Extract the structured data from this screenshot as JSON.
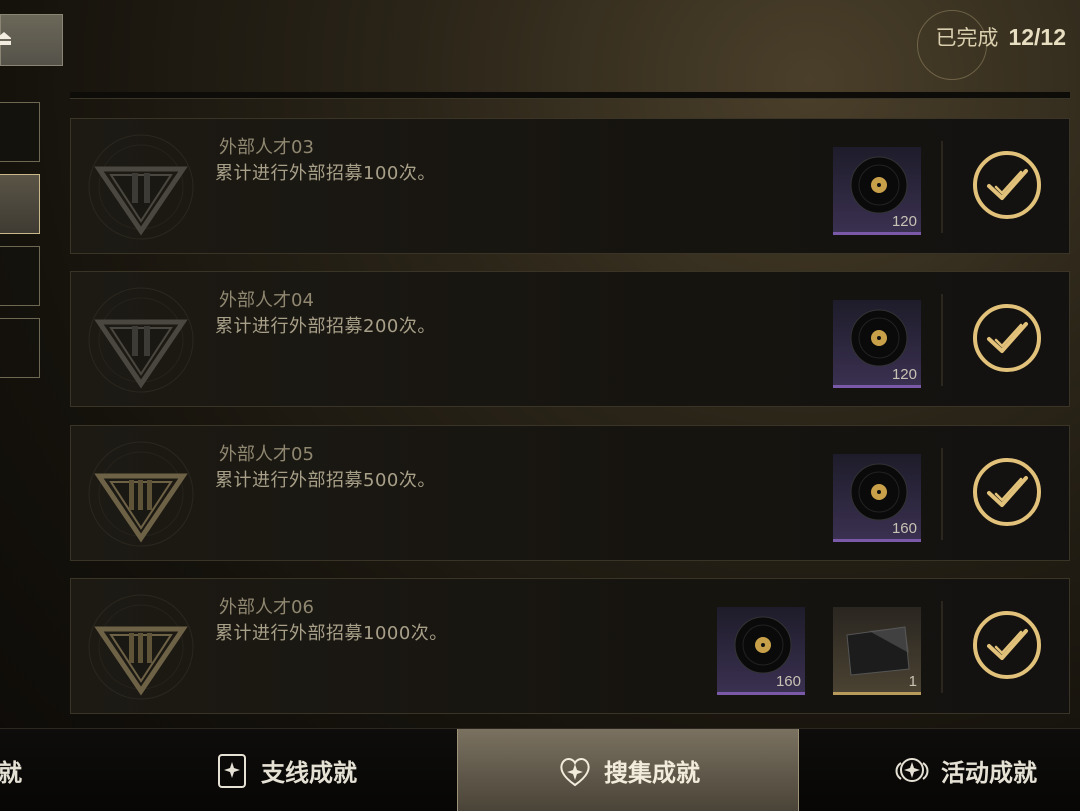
{
  "header": {
    "completed_label": "已完成",
    "completed_value": "12/12"
  },
  "side_tabs": [
    {
      "id": "side-tab-1"
    },
    {
      "id": "side-tab-2"
    },
    {
      "id": "side-tab-3"
    },
    {
      "id": "side-tab-4"
    }
  ],
  "achievements": [
    {
      "title": "外部人才03",
      "desc": "累计进行外部招募100次。",
      "tier": "II",
      "rewards": [
        {
          "type": "record",
          "count": "120"
        }
      ],
      "completed": true
    },
    {
      "title": "外部人才04",
      "desc": "累计进行外部招募200次。",
      "tier": "II",
      "rewards": [
        {
          "type": "record",
          "count": "120"
        }
      ],
      "completed": true
    },
    {
      "title": "外部人才05",
      "desc": "累计进行外部招募500次。",
      "tier": "III",
      "rewards": [
        {
          "type": "record",
          "count": "160"
        }
      ],
      "completed": true
    },
    {
      "title": "外部人才06",
      "desc": "累计进行外部招募1000次。",
      "tier": "III",
      "rewards": [
        {
          "type": "record",
          "count": "160"
        },
        {
          "type": "card",
          "count": "1"
        }
      ],
      "completed": true
    }
  ],
  "bottom_tabs": [
    {
      "label": "就",
      "icon": "none"
    },
    {
      "label": "支线成就",
      "icon": "card-star-icon"
    },
    {
      "label": "搜集成就",
      "icon": "heart-star-icon"
    },
    {
      "label": "活动成就",
      "icon": "wing-star-icon"
    }
  ],
  "colors": {
    "accent_gold": "#e2c27a",
    "reward_purple": "#7a5aa8"
  }
}
